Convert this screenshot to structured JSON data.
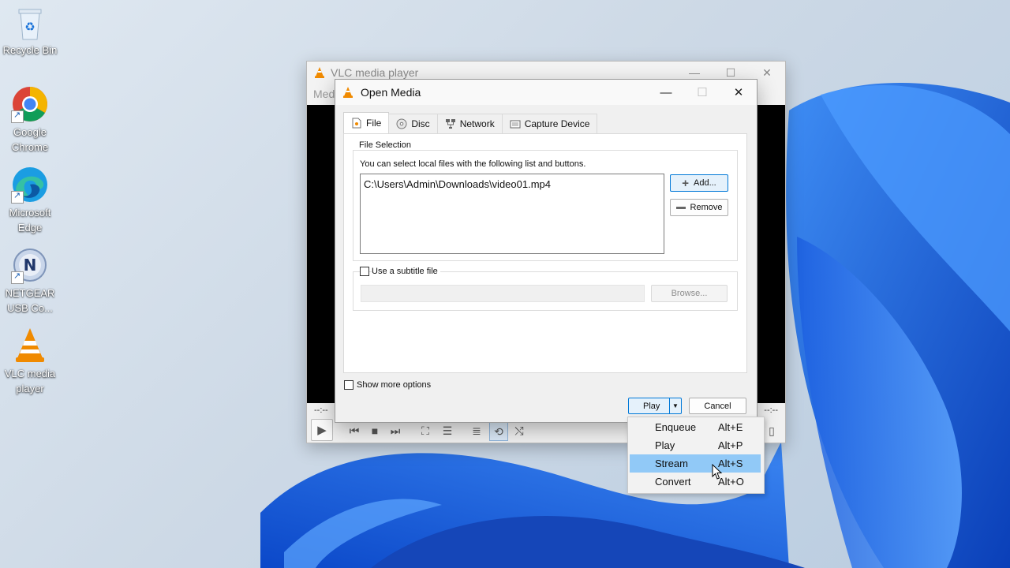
{
  "desktop": {
    "icons": [
      {
        "label": "Recycle Bin",
        "icon": "recycle-bin-icon"
      },
      {
        "label": "Google Chrome",
        "icon": "chrome-icon"
      },
      {
        "label": "Microsoft Edge",
        "icon": "edge-icon"
      },
      {
        "label": "NETGEAR USB Co...",
        "icon": "netgear-icon"
      },
      {
        "label": "VLC media player",
        "icon": "vlc-icon"
      }
    ]
  },
  "vlc_main": {
    "title": "VLC media player",
    "menu_partial": "Med",
    "time_left": "--:--",
    "time_right": "--:--"
  },
  "dialog": {
    "title": "Open Media",
    "tabs": [
      {
        "label": "File",
        "icon": "file-icon",
        "active": true
      },
      {
        "label": "Disc",
        "icon": "disc-icon"
      },
      {
        "label": "Network",
        "icon": "network-icon"
      },
      {
        "label": "Capture Device",
        "icon": "capture-device-icon"
      }
    ],
    "file_selection": {
      "group_label": "File Selection",
      "hint": "You can select local files with the following list and buttons.",
      "files": [
        "C:\\Users\\Admin\\Downloads\\video01.mp4"
      ],
      "add_label": "Add...",
      "remove_label": "Remove"
    },
    "subtitle": {
      "checkbox_label": "Use a subtitle file",
      "checked": false,
      "browse_label": "Browse..."
    },
    "show_more_options": {
      "label": "Show more options",
      "checked": false
    },
    "play_label": "Play",
    "cancel_label": "Cancel"
  },
  "play_menu": {
    "items": [
      {
        "label": "Enqueue",
        "shortcut": "Alt+E"
      },
      {
        "label": "Play",
        "shortcut": "Alt+P"
      },
      {
        "label": "Stream",
        "shortcut": "Alt+S",
        "highlighted": true
      },
      {
        "label": "Convert",
        "shortcut": "Alt+O"
      }
    ]
  },
  "colors": {
    "wallpaper_blue": "#1a64e0",
    "highlight": "#91c9f7",
    "focus_border": "#0078d7",
    "vlc_orange": "#f08a00"
  }
}
